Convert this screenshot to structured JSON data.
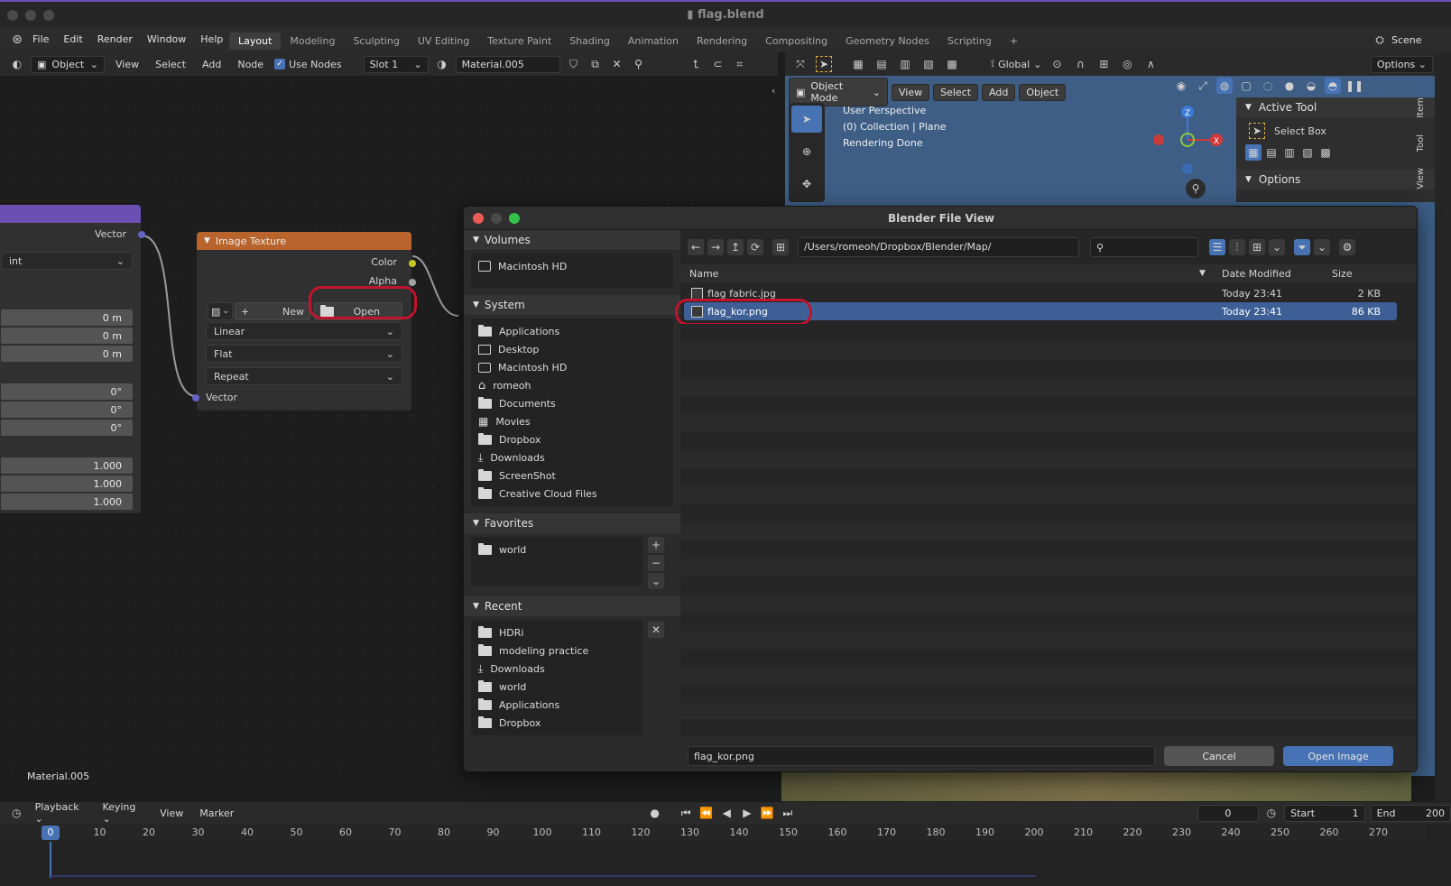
{
  "window": {
    "title": "flag.blend"
  },
  "menu": [
    "File",
    "Edit",
    "Render",
    "Window",
    "Help"
  ],
  "workspaces": [
    {
      "label": "Layout",
      "active": true
    },
    {
      "label": "Modeling"
    },
    {
      "label": "Sculpting"
    },
    {
      "label": "UV Editing"
    },
    {
      "label": "Texture Paint"
    },
    {
      "label": "Shading"
    },
    {
      "label": "Animation"
    },
    {
      "label": "Rendering"
    },
    {
      "label": "Compositing"
    },
    {
      "label": "Geometry Nodes"
    },
    {
      "label": "Scripting"
    }
  ],
  "scene_label": "Scene",
  "node_header": {
    "object_mode": "Object",
    "menus": [
      "View",
      "Select",
      "Add",
      "Node"
    ],
    "use_nodes_label": "Use Nodes",
    "slot": "Slot 1",
    "material": "Material.005"
  },
  "viewport_header": {
    "orientation": "Global",
    "options": "Options"
  },
  "viewport_sub": {
    "mode": "Object Mode",
    "menus": [
      "View",
      "Select",
      "Add",
      "Object"
    ]
  },
  "viewport_overlay": [
    "User Perspective",
    "(0) Collection | Plane",
    "Rendering Done"
  ],
  "gizmo": {
    "z": "Z",
    "x": "X"
  },
  "n_panel": {
    "active_tool_label": "Active Tool",
    "tool_name": "Select Box",
    "options_label": "Options",
    "tabs": [
      "Item",
      "Tool",
      "View"
    ]
  },
  "mapping_node": {
    "vector_out": "Vector",
    "type_dropdown": "int",
    "location": [
      "0 m",
      "0 m",
      "0 m"
    ],
    "rotation": [
      "0°",
      "0°",
      "0°"
    ],
    "scale": [
      "1.000",
      "1.000",
      "1.000"
    ]
  },
  "image_texture_node": {
    "title": "Image Texture",
    "outputs": [
      "Color",
      "Alpha"
    ],
    "new_label": "New",
    "open_label": "Open",
    "interpolation": "Linear",
    "projection": "Flat",
    "extension": "Repeat",
    "vector_in": "Vector"
  },
  "material_label": "Material.005",
  "dialog": {
    "title": "Blender File View",
    "path": "/Users/romeoh/Dropbox/Blender/Map/",
    "search_placeholder": "",
    "columns": {
      "name": "Name",
      "date": "Date Modified",
      "size": "Size"
    },
    "files": [
      {
        "name": "flag fabric.jpg",
        "date": "Today 23:41",
        "size": "2 KB",
        "selected": false
      },
      {
        "name": "flag_kor.png",
        "date": "Today 23:41",
        "size": "86 KB",
        "selected": true
      }
    ],
    "filename": "flag_kor.png",
    "cancel_label": "Cancel",
    "confirm_label": "Open Image",
    "volumes_title": "Volumes",
    "volumes": [
      "Macintosh HD"
    ],
    "system_title": "System",
    "system": [
      {
        "label": "Applications",
        "icon": "folder-icon"
      },
      {
        "label": "Desktop",
        "icon": "desktop-icon"
      },
      {
        "label": "Macintosh HD",
        "icon": "disk-icon"
      },
      {
        "label": "romeoh",
        "icon": "home-icon"
      },
      {
        "label": "Documents",
        "icon": "folder-icon"
      },
      {
        "label": "Movies",
        "icon": "film-icon"
      },
      {
        "label": "Dropbox",
        "icon": "folder-icon"
      },
      {
        "label": "Downloads",
        "icon": "download-icon"
      },
      {
        "label": "ScreenShot",
        "icon": "folder-icon"
      },
      {
        "label": "Creative Cloud Files",
        "icon": "folder-icon"
      }
    ],
    "favorites_title": "Favorites",
    "favorites": [
      "world"
    ],
    "recent_title": "Recent",
    "recent": [
      {
        "label": "HDRi",
        "icon": "folder-icon"
      },
      {
        "label": "modeling practice",
        "icon": "folder-icon"
      },
      {
        "label": "Downloads",
        "icon": "download-icon"
      },
      {
        "label": "world",
        "icon": "folder-icon"
      },
      {
        "label": "Applications",
        "icon": "folder-icon"
      },
      {
        "label": "Dropbox",
        "icon": "folder-icon"
      }
    ]
  },
  "timeline": {
    "menus": [
      "Playback",
      "Keying",
      "View",
      "Marker"
    ],
    "current_frame": "0",
    "start_label": "Start",
    "start": "1",
    "end_label": "End",
    "end": "200",
    "ticks": [
      "0",
      "10",
      "20",
      "30",
      "40",
      "50",
      "60",
      "70",
      "80",
      "90",
      "100",
      "110",
      "120",
      "130",
      "140",
      "150",
      "160",
      "170",
      "180",
      "190",
      "200",
      "210",
      "220",
      "230",
      "240",
      "250",
      "260",
      "270"
    ]
  },
  "colors": {
    "accent_blue": "#4772b3",
    "selection_blue": "#3d5f96",
    "annotation_red": "#c0142e",
    "image_node_header": "#b8642c",
    "mapping_node_header": "#6b4fb3",
    "viewport_bg": "#3e5e86"
  }
}
